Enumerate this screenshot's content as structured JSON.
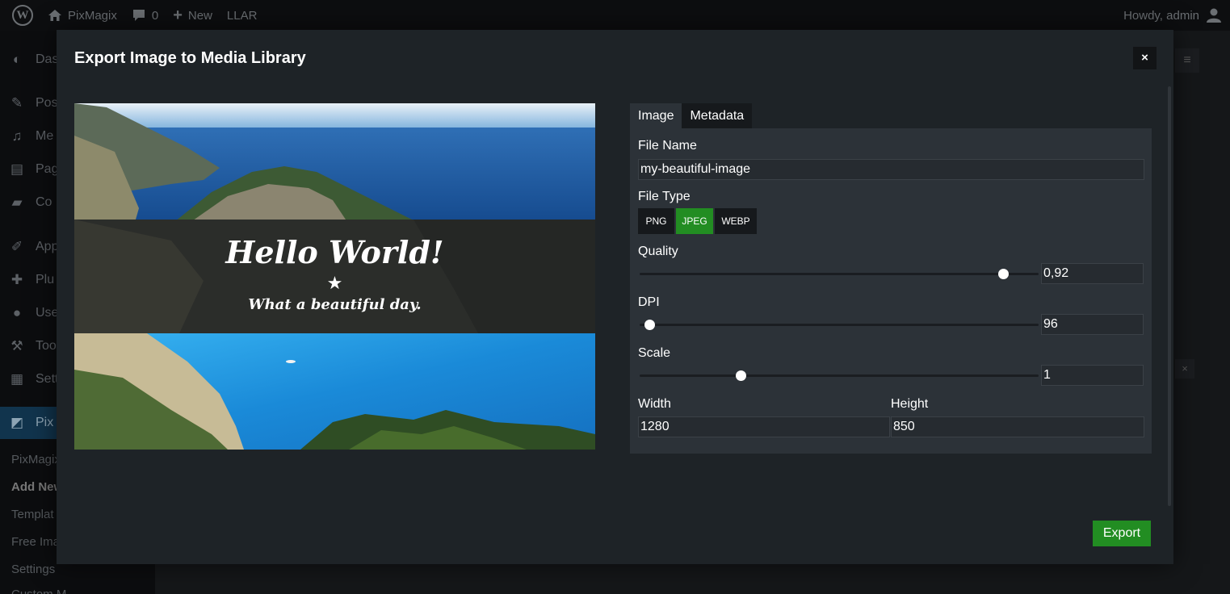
{
  "adminbar": {
    "site_name": "PixMagix",
    "comments_count": "0",
    "new_label": "New",
    "llar_label": "LLAR",
    "greeting": "Howdy, admin"
  },
  "sidebar": {
    "items": [
      {
        "label": "Das",
        "icon": "dashboard-icon"
      },
      {
        "label": "Pos",
        "icon": "pin-icon"
      },
      {
        "label": "Me",
        "icon": "media-icon"
      },
      {
        "label": "Pag",
        "icon": "pages-icon"
      },
      {
        "label": "Co",
        "icon": "comments-icon"
      },
      {
        "label": "App",
        "icon": "appearance-icon"
      },
      {
        "label": "Plu",
        "icon": "plugins-icon"
      },
      {
        "label": "Use",
        "icon": "users-icon"
      },
      {
        "label": "Too",
        "icon": "tools-icon"
      },
      {
        "label": "Sett",
        "icon": "settings-icon"
      },
      {
        "label": "Pix",
        "icon": "pixmagix-icon"
      }
    ],
    "subitems": [
      "PixMagix",
      "Add New",
      "Templat",
      "Free Ima",
      "Settings",
      "Custom M"
    ]
  },
  "modal": {
    "title": "Export Image to Media Library",
    "close_label": "×",
    "tabs": [
      "Image",
      "Metadata"
    ],
    "file_name_label": "File Name",
    "file_name_value": "my-beautiful-image",
    "file_type_label": "File Type",
    "file_types": [
      "PNG",
      "JPEG",
      "WEBP"
    ],
    "file_type_selected": "JPEG",
    "quality_label": "Quality",
    "quality_value": "0,92",
    "dpi_label": "DPI",
    "dpi_value": "96",
    "scale_label": "Scale",
    "scale_value": "1",
    "width_label": "Width",
    "width_value": "1280",
    "height_label": "Height",
    "height_value": "850",
    "export_label": "Export"
  },
  "preview": {
    "headline": "Hello World!",
    "star": "★",
    "subtitle": "What a beautiful day."
  },
  "colors": {
    "accent_green": "#228d22",
    "modal_bg": "#1e2327",
    "panel_bg": "#2c3238"
  }
}
